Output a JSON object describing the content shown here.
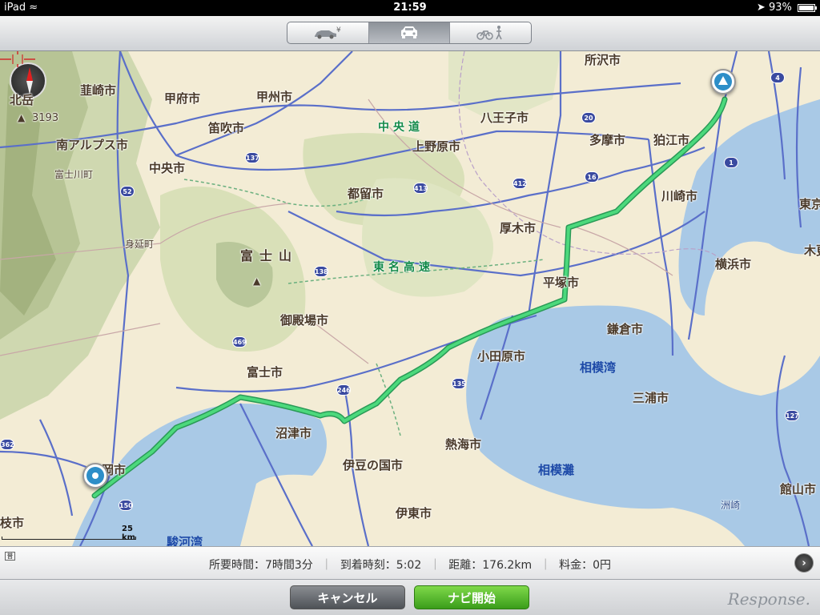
{
  "status_bar": {
    "device": "iPad",
    "time": "21:59",
    "battery": "93%",
    "icons": [
      "wifi-icon",
      "location-arrow-icon",
      "battery-icon"
    ]
  },
  "toolbar": {
    "toll_segment_symbol": "¥",
    "segments": [
      {
        "name": "toll-car",
        "icon": "car-yen-icon",
        "selected": false
      },
      {
        "name": "car",
        "icon": "car-icon",
        "selected": true
      },
      {
        "name": "bike-walk",
        "icon": "bicycle-walk-icon",
        "selected": false
      }
    ]
  },
  "map": {
    "compass_label": "北岳",
    "peak_height": "3193",
    "mountain_label": "富士山",
    "expressways": [
      "中央道",
      "東名高速"
    ],
    "cities": [
      {
        "label": "韮崎市"
      },
      {
        "label": "甲府市"
      },
      {
        "label": "甲州市"
      },
      {
        "label": "笛吹市"
      },
      {
        "label": "南アルプス市"
      },
      {
        "label": "中央市"
      },
      {
        "label": "富士川町"
      },
      {
        "label": "身延町"
      },
      {
        "label": "都留市"
      },
      {
        "label": "上野原市"
      },
      {
        "label": "八王子市"
      },
      {
        "label": "所沢市"
      },
      {
        "label": "多摩市"
      },
      {
        "label": "狛江市"
      },
      {
        "label": "川崎市"
      },
      {
        "label": "東京"
      },
      {
        "label": "厚木市"
      },
      {
        "label": "横浜市"
      },
      {
        "label": "平塚市"
      },
      {
        "label": "御殿場市"
      },
      {
        "label": "富士市"
      },
      {
        "label": "鎌倉市"
      },
      {
        "label": "小田原市"
      },
      {
        "label": "三浦市"
      },
      {
        "label": "沼津市"
      },
      {
        "label": "熱海市"
      },
      {
        "label": "伊豆の国市"
      },
      {
        "label": "伊東市"
      },
      {
        "label": "静岡市"
      },
      {
        "label": "館山市"
      },
      {
        "label": "枝市"
      },
      {
        "label": "木更"
      }
    ],
    "seas": [
      "相模湾",
      "相模灘",
      "駿河湾"
    ],
    "small_places": [
      "洲崎"
    ],
    "route_shields": [
      "137",
      "52",
      "20",
      "16",
      "412",
      "413",
      "138",
      "469",
      "246",
      "135",
      "1",
      "4",
      "127",
      "362",
      "150"
    ],
    "scale_label": "25 km",
    "route_color": "#3fce73"
  },
  "route_info": {
    "mode_icon": "普",
    "duration_label": "所要時間：7時間3分",
    "arrival_label": "到着時刻：5:02",
    "distance_label": "距離：176.2km",
    "toll_label": "料金：0円",
    "separator": "｜"
  },
  "actions": {
    "cancel_label": "キャンセル",
    "start_label": "ナビ開始"
  },
  "watermark": "Response."
}
